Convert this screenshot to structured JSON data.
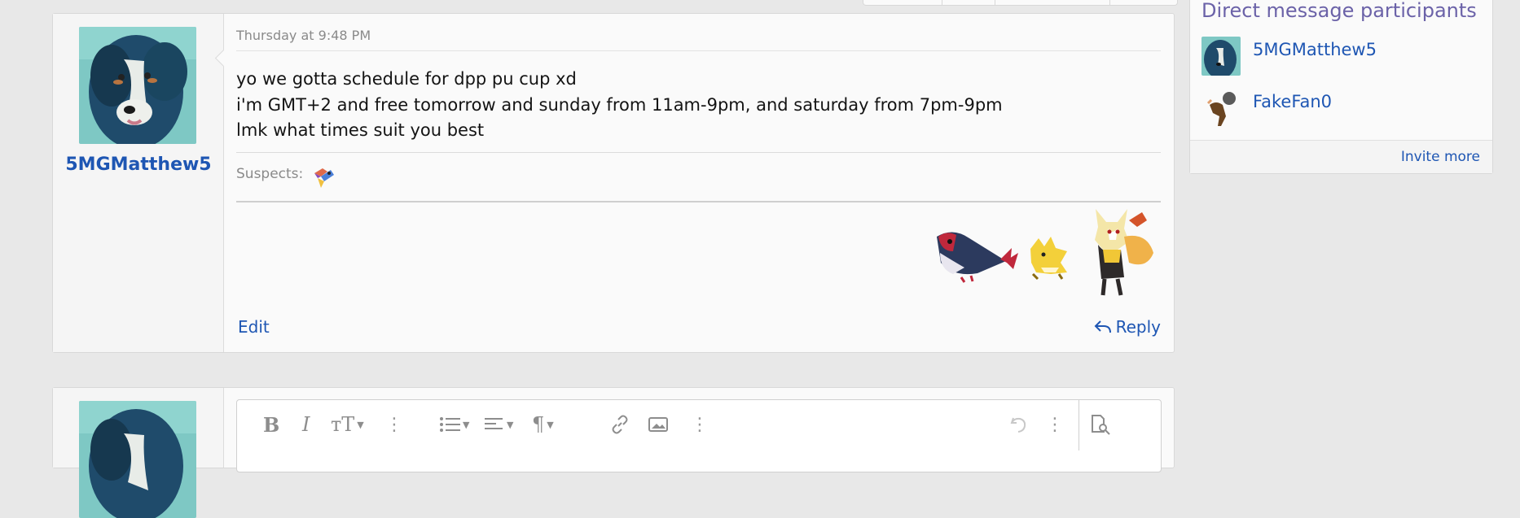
{
  "message": {
    "author": "5MGMatthew5",
    "timestamp": "Thursday at 9:48 PM",
    "body_lines": [
      "yo we gotta schedule for dpp pu cup xd",
      "i'm GMT+2 and free tomorrow and sunday from 11am-9pm, and saturday from 7pm-9pm",
      "lmk what times suit you best"
    ],
    "suspects_label": "Suspects:",
    "edit_label": "Edit",
    "reply_label": "Reply"
  },
  "sidebar": {
    "title": "Direct message participants",
    "participants": [
      {
        "name": "5MGMatthew5"
      },
      {
        "name": "FakeFan0"
      }
    ],
    "invite_label": "Invite more"
  },
  "editor": {
    "tools": [
      "bold-icon",
      "italic-icon",
      "text-size-icon",
      "more-icon",
      "list-icon",
      "align-icon",
      "paragraph-icon",
      "link-icon",
      "image-icon",
      "more-icon",
      "undo-icon",
      "more-icon",
      "preview-icon"
    ]
  },
  "colors": {
    "link": "#1e56b3",
    "sidebar_title": "#6b62a8",
    "page_bg": "#e8e8e8"
  }
}
